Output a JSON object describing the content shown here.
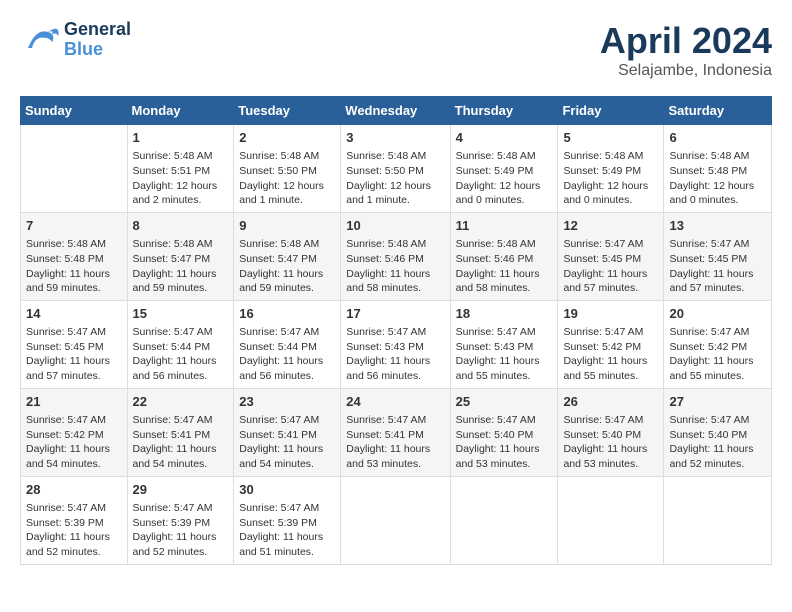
{
  "header": {
    "logo_general": "General",
    "logo_blue": "Blue",
    "month": "April 2024",
    "location": "Selajambe, Indonesia"
  },
  "days_of_week": [
    "Sunday",
    "Monday",
    "Tuesday",
    "Wednesday",
    "Thursday",
    "Friday",
    "Saturday"
  ],
  "weeks": [
    [
      {
        "day": "",
        "info": ""
      },
      {
        "day": "1",
        "info": "Sunrise: 5:48 AM\nSunset: 5:51 PM\nDaylight: 12 hours\nand 2 minutes."
      },
      {
        "day": "2",
        "info": "Sunrise: 5:48 AM\nSunset: 5:50 PM\nDaylight: 12 hours\nand 1 minute."
      },
      {
        "day": "3",
        "info": "Sunrise: 5:48 AM\nSunset: 5:50 PM\nDaylight: 12 hours\nand 1 minute."
      },
      {
        "day": "4",
        "info": "Sunrise: 5:48 AM\nSunset: 5:49 PM\nDaylight: 12 hours\nand 0 minutes."
      },
      {
        "day": "5",
        "info": "Sunrise: 5:48 AM\nSunset: 5:49 PM\nDaylight: 12 hours\nand 0 minutes."
      },
      {
        "day": "6",
        "info": "Sunrise: 5:48 AM\nSunset: 5:48 PM\nDaylight: 12 hours\nand 0 minutes."
      }
    ],
    [
      {
        "day": "7",
        "info": "Sunrise: 5:48 AM\nSunset: 5:48 PM\nDaylight: 11 hours\nand 59 minutes."
      },
      {
        "day": "8",
        "info": "Sunrise: 5:48 AM\nSunset: 5:47 PM\nDaylight: 11 hours\nand 59 minutes."
      },
      {
        "day": "9",
        "info": "Sunrise: 5:48 AM\nSunset: 5:47 PM\nDaylight: 11 hours\nand 59 minutes."
      },
      {
        "day": "10",
        "info": "Sunrise: 5:48 AM\nSunset: 5:46 PM\nDaylight: 11 hours\nand 58 minutes."
      },
      {
        "day": "11",
        "info": "Sunrise: 5:48 AM\nSunset: 5:46 PM\nDaylight: 11 hours\nand 58 minutes."
      },
      {
        "day": "12",
        "info": "Sunrise: 5:47 AM\nSunset: 5:45 PM\nDaylight: 11 hours\nand 57 minutes."
      },
      {
        "day": "13",
        "info": "Sunrise: 5:47 AM\nSunset: 5:45 PM\nDaylight: 11 hours\nand 57 minutes."
      }
    ],
    [
      {
        "day": "14",
        "info": "Sunrise: 5:47 AM\nSunset: 5:45 PM\nDaylight: 11 hours\nand 57 minutes."
      },
      {
        "day": "15",
        "info": "Sunrise: 5:47 AM\nSunset: 5:44 PM\nDaylight: 11 hours\nand 56 minutes."
      },
      {
        "day": "16",
        "info": "Sunrise: 5:47 AM\nSunset: 5:44 PM\nDaylight: 11 hours\nand 56 minutes."
      },
      {
        "day": "17",
        "info": "Sunrise: 5:47 AM\nSunset: 5:43 PM\nDaylight: 11 hours\nand 56 minutes."
      },
      {
        "day": "18",
        "info": "Sunrise: 5:47 AM\nSunset: 5:43 PM\nDaylight: 11 hours\nand 55 minutes."
      },
      {
        "day": "19",
        "info": "Sunrise: 5:47 AM\nSunset: 5:42 PM\nDaylight: 11 hours\nand 55 minutes."
      },
      {
        "day": "20",
        "info": "Sunrise: 5:47 AM\nSunset: 5:42 PM\nDaylight: 11 hours\nand 55 minutes."
      }
    ],
    [
      {
        "day": "21",
        "info": "Sunrise: 5:47 AM\nSunset: 5:42 PM\nDaylight: 11 hours\nand 54 minutes."
      },
      {
        "day": "22",
        "info": "Sunrise: 5:47 AM\nSunset: 5:41 PM\nDaylight: 11 hours\nand 54 minutes."
      },
      {
        "day": "23",
        "info": "Sunrise: 5:47 AM\nSunset: 5:41 PM\nDaylight: 11 hours\nand 54 minutes."
      },
      {
        "day": "24",
        "info": "Sunrise: 5:47 AM\nSunset: 5:41 PM\nDaylight: 11 hours\nand 53 minutes."
      },
      {
        "day": "25",
        "info": "Sunrise: 5:47 AM\nSunset: 5:40 PM\nDaylight: 11 hours\nand 53 minutes."
      },
      {
        "day": "26",
        "info": "Sunrise: 5:47 AM\nSunset: 5:40 PM\nDaylight: 11 hours\nand 53 minutes."
      },
      {
        "day": "27",
        "info": "Sunrise: 5:47 AM\nSunset: 5:40 PM\nDaylight: 11 hours\nand 52 minutes."
      }
    ],
    [
      {
        "day": "28",
        "info": "Sunrise: 5:47 AM\nSunset: 5:39 PM\nDaylight: 11 hours\nand 52 minutes."
      },
      {
        "day": "29",
        "info": "Sunrise: 5:47 AM\nSunset: 5:39 PM\nDaylight: 11 hours\nand 52 minutes."
      },
      {
        "day": "30",
        "info": "Sunrise: 5:47 AM\nSunset: 5:39 PM\nDaylight: 11 hours\nand 51 minutes."
      },
      {
        "day": "",
        "info": ""
      },
      {
        "day": "",
        "info": ""
      },
      {
        "day": "",
        "info": ""
      },
      {
        "day": "",
        "info": ""
      }
    ]
  ]
}
